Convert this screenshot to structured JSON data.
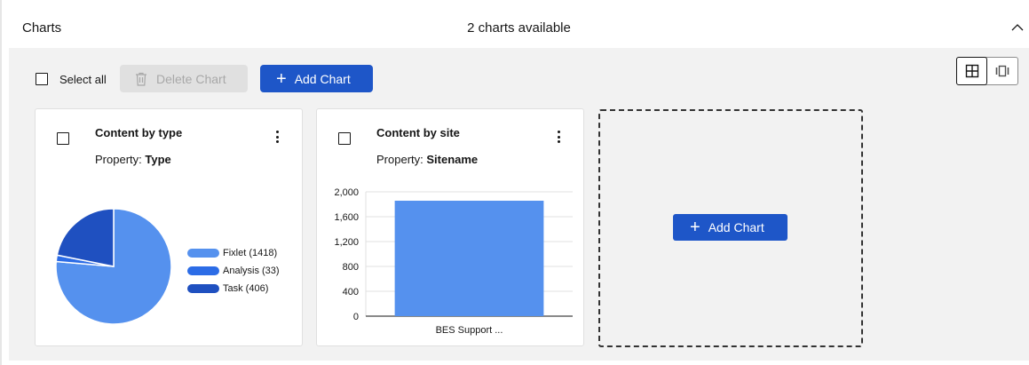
{
  "header": {
    "title": "Charts",
    "count_text": "2 charts available"
  },
  "toolbar": {
    "select_all_label": "Select all",
    "delete_label": "Delete Chart",
    "add_label": "Add Chart"
  },
  "cards": [
    {
      "title": "Content by type",
      "property_prefix": "Property: ",
      "property_value": "Type",
      "chart_kind": "pie",
      "legend": [
        {
          "label": "Fixlet (1418)",
          "color": "#5591ee"
        },
        {
          "label": "Analysis (33)",
          "color": "#2c6ce6"
        },
        {
          "label": "Task (406)",
          "color": "#1f50c0"
        }
      ]
    },
    {
      "title": "Content by site",
      "property_prefix": "Property: ",
      "property_value": "Sitename",
      "chart_kind": "bar"
    }
  ],
  "empty_slot": {
    "add_label": "Add Chart"
  },
  "colors": {
    "accent": "#1e56c8",
    "pie_fixlet": "#5591ee",
    "pie_analysis": "#2c6ce6",
    "pie_task": "#1f50c0",
    "bar": "#5591ee"
  },
  "chart_data": [
    {
      "type": "pie",
      "categories": [
        "Fixlet (1418)",
        "Analysis (33)",
        "Task (406)"
      ],
      "values": [
        1418,
        33,
        406
      ],
      "colors": [
        "#5591ee",
        "#2c6ce6",
        "#1f50c0"
      ]
    },
    {
      "type": "bar",
      "categories": [
        "BES Support ..."
      ],
      "values": [
        1857
      ],
      "ylim": [
        0,
        2000
      ],
      "yticks": [
        "0",
        "400",
        "800",
        "1,200",
        "1,600",
        "2,000"
      ],
      "grid": true
    }
  ]
}
